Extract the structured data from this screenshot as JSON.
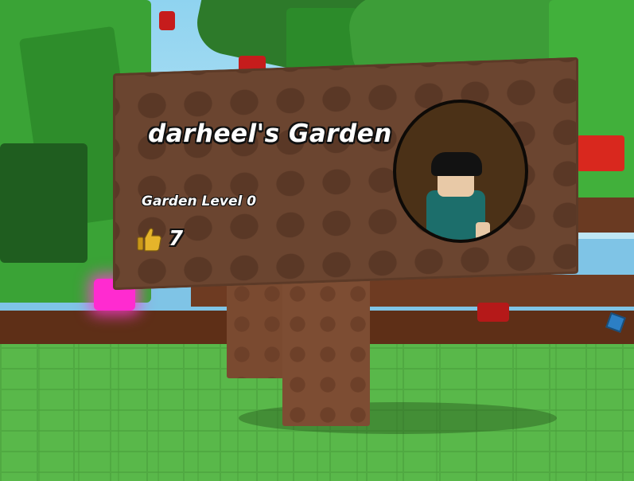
{
  "sign": {
    "title": "darheel's Garden",
    "level_text": "Garden Level 0",
    "likes": "7"
  },
  "icons": {
    "likes_icon": "thumbs-up-icon",
    "avatar_icon": "player-avatar"
  },
  "colors": {
    "sign_wood": "#6b4530",
    "grass": "#57b548",
    "text": "#ffffff",
    "thumb": "#e0b227"
  }
}
